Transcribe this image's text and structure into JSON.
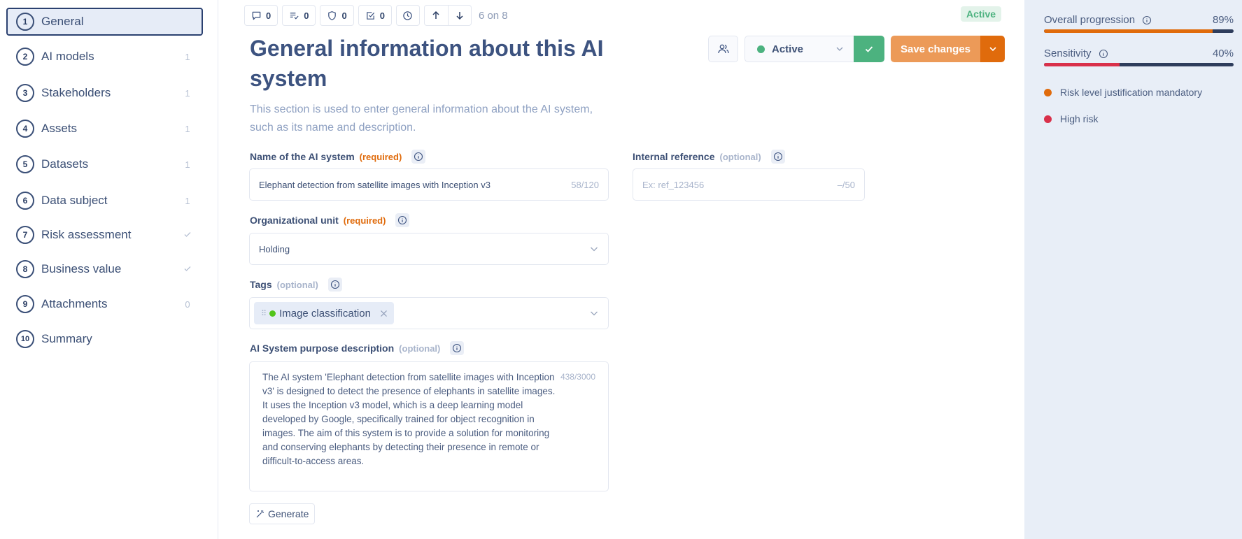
{
  "sidebar": {
    "items": [
      {
        "num": "1",
        "label": "General",
        "badge": ""
      },
      {
        "num": "2",
        "label": "AI models",
        "badge": "1"
      },
      {
        "num": "3",
        "label": "Stakeholders",
        "badge": "1"
      },
      {
        "num": "4",
        "label": "Assets",
        "badge": "1"
      },
      {
        "num": "5",
        "label": "Datasets",
        "badge": "1"
      },
      {
        "num": "6",
        "label": "Data subject",
        "badge": "1"
      },
      {
        "num": "7",
        "label": "Risk assessment",
        "badge": "check"
      },
      {
        "num": "8",
        "label": "Business value",
        "badge": "check"
      },
      {
        "num": "9",
        "label": "Attachments",
        "badge": "0"
      },
      {
        "num": "10",
        "label": "Summary",
        "badge": ""
      }
    ]
  },
  "toolbar": {
    "comments_count": "0",
    "tasks_count": "0",
    "controls_count": "0",
    "checks_count": "0",
    "pager": "6 on 8"
  },
  "status_pill": "Active",
  "header": {
    "title": "General information about this AI system",
    "description": "This section is used to enter general information about the AI system, such as its name and description."
  },
  "actions": {
    "status_value": "Active",
    "status_color": "#4cb27f",
    "save_label": "Save changes"
  },
  "form": {
    "name": {
      "label": "Name of the AI system",
      "qualifier": "(required)",
      "value": "Elephant detection from satellite images with Inception v3",
      "counter": "58/120"
    },
    "internal_ref": {
      "label": "Internal reference",
      "qualifier": "(optional)",
      "placeholder": "Ex: ref_123456",
      "counter": "–/50"
    },
    "org_unit": {
      "label": "Organizational unit",
      "qualifier": "(required)",
      "value": "Holding"
    },
    "tags": {
      "label": "Tags",
      "qualifier": "(optional)",
      "items": [
        {
          "label": "Image classification",
          "color": "#52c41a"
        }
      ]
    },
    "purpose": {
      "label": "AI System purpose description",
      "qualifier": "(optional)",
      "value": "The AI system 'Elephant detection from satellite images with Inception v3' is designed to detect the presence of elephants in satellite images. It uses the Inception v3 model, which is a deep learning model developed by Google, specifically trained for object recognition in images. The aim of this system is to provide a solution for monitoring and conserving elephants by detecting their presence in remote or difficult-to-access areas.",
      "counter": "438/3000"
    },
    "generate_label": "Generate"
  },
  "right_panel": {
    "metrics": [
      {
        "name": "Overall progression",
        "percent_label": "89%",
        "value": 89,
        "color": "#e06b0c"
      },
      {
        "name": "Sensitivity",
        "percent_label": "40%",
        "value": 40,
        "color": "#d9304a"
      }
    ],
    "alerts": [
      {
        "label": "Risk level justification mandatory",
        "color": "#e06b0c"
      },
      {
        "label": "High risk",
        "color": "#d9304a"
      }
    ]
  }
}
